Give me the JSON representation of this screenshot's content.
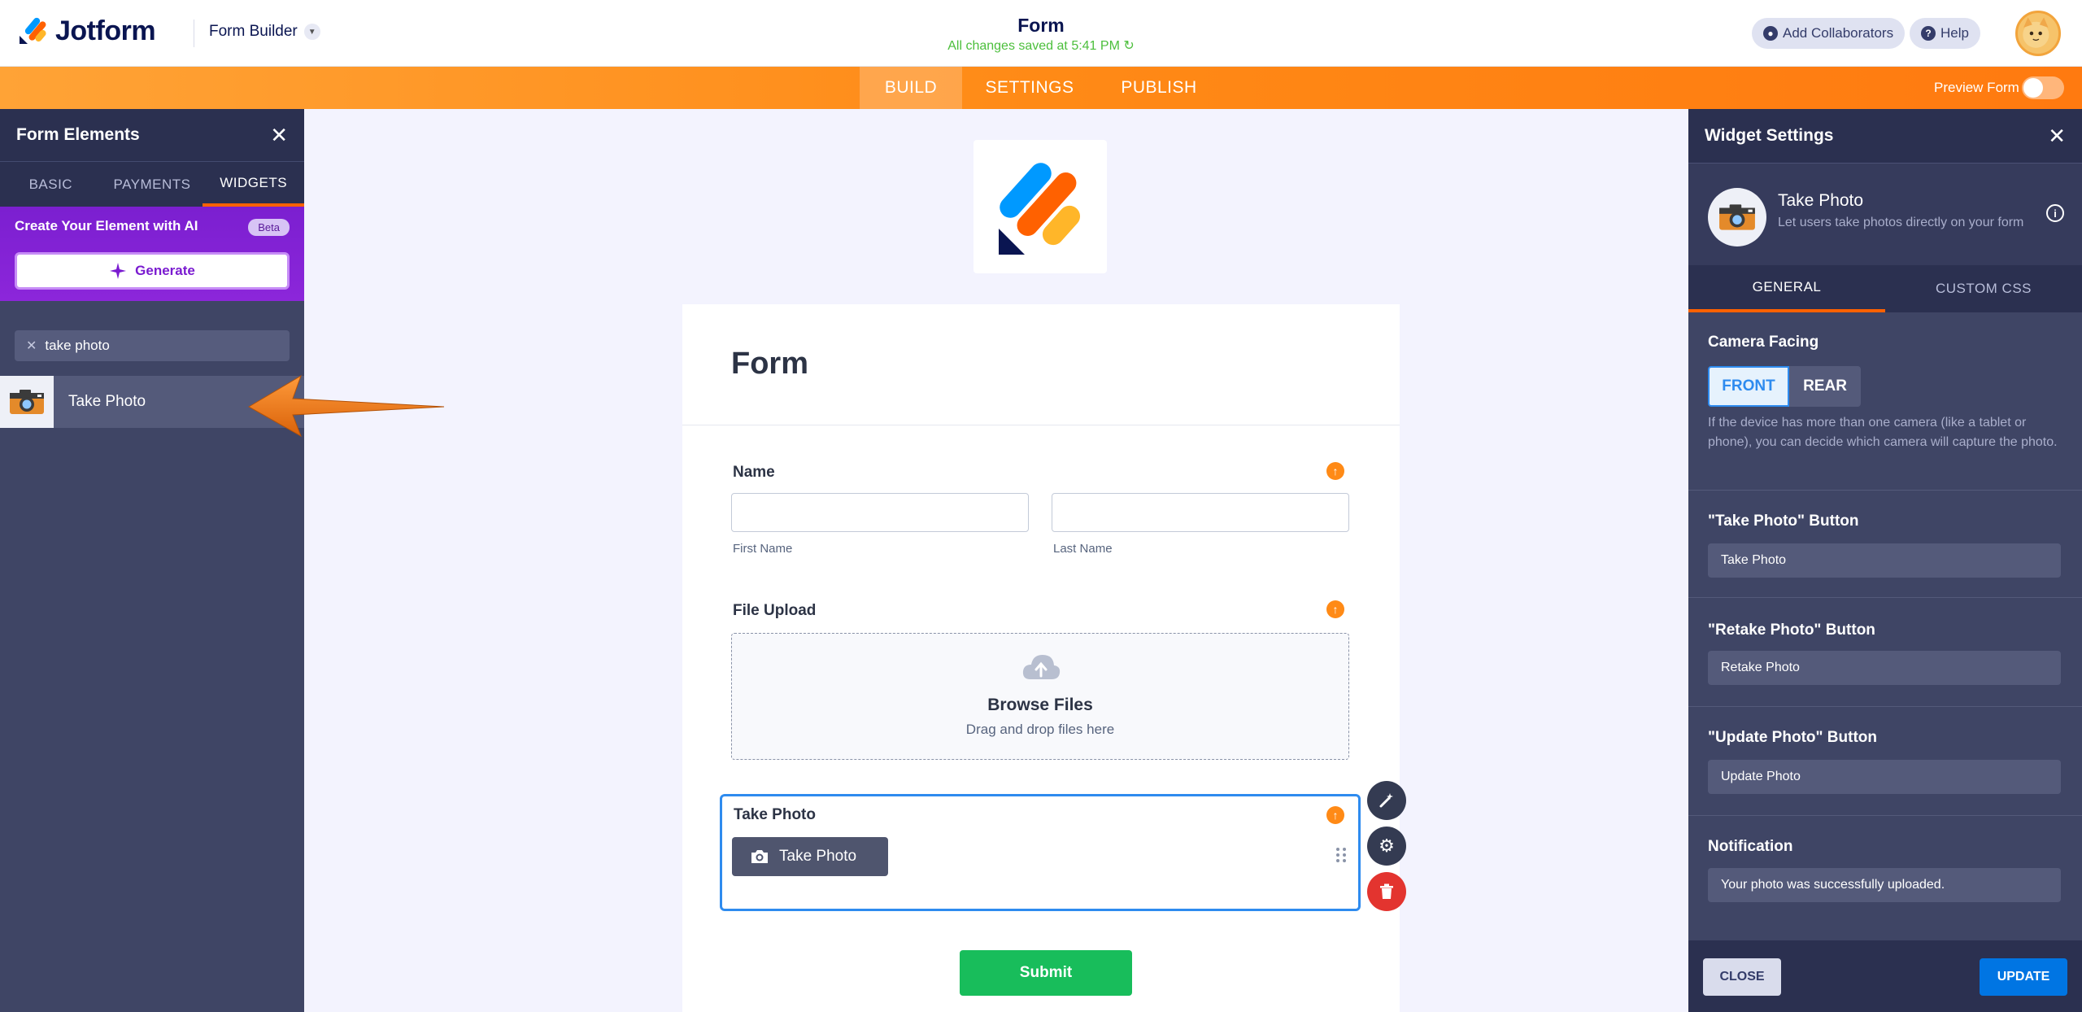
{
  "app": {
    "brand": "Jotform",
    "builder_label": "Form Builder",
    "form_title": "Form",
    "saved_status": "All changes saved at 5:41 PM",
    "add_collaborators": "Add Collaborators",
    "help": "Help",
    "accent_color": "#ff8a16"
  },
  "nav": {
    "tabs": [
      "BUILD",
      "SETTINGS",
      "PUBLISH"
    ],
    "active_tab": "BUILD",
    "preview_label": "Preview Form"
  },
  "left_panel": {
    "title": "Form Elements",
    "tabs": [
      "BASIC",
      "PAYMENTS",
      "WIDGETS"
    ],
    "active_tab": "WIDGETS",
    "ai_title": "Create Your Element with AI",
    "ai_badge": "Beta",
    "generate_label": "Generate",
    "search_value": "take photo",
    "results": [
      {
        "label": "Take Photo",
        "icon": "camera-icon"
      }
    ]
  },
  "form": {
    "heading": "Form",
    "name_label": "Name",
    "first_name_sublabel": "First Name",
    "last_name_sublabel": "Last Name",
    "file_upload_label": "File Upload",
    "browse_files": "Browse Files",
    "drag_drop": "Drag and drop files here",
    "take_photo_label": "Take Photo",
    "take_photo_button": "Take Photo",
    "submit_label": "Submit"
  },
  "right_panel": {
    "title": "Widget Settings",
    "widget_name": "Take Photo",
    "widget_desc": "Let users take photos directly on your form",
    "tabs": [
      "GENERAL",
      "CUSTOM CSS"
    ],
    "active_tab": "GENERAL",
    "camera_facing_label": "Camera Facing",
    "camera_options": [
      "FRONT",
      "REAR"
    ],
    "camera_selected": "FRONT",
    "camera_help": "If the device has more than one camera (like a tablet or phone), you can decide which camera will capture the photo.",
    "take_photo_btn_label": "\"Take Photo\" Button",
    "take_photo_btn_value": "Take Photo",
    "retake_btn_label": "\"Retake Photo\" Button",
    "retake_btn_value": "Retake Photo",
    "update_btn_label": "\"Update Photo\" Button",
    "update_btn_value": "Update Photo",
    "notification_label": "Notification",
    "notification_value": "Your photo was successfully uploaded.",
    "close_label": "CLOSE",
    "update_label": "UPDATE"
  }
}
